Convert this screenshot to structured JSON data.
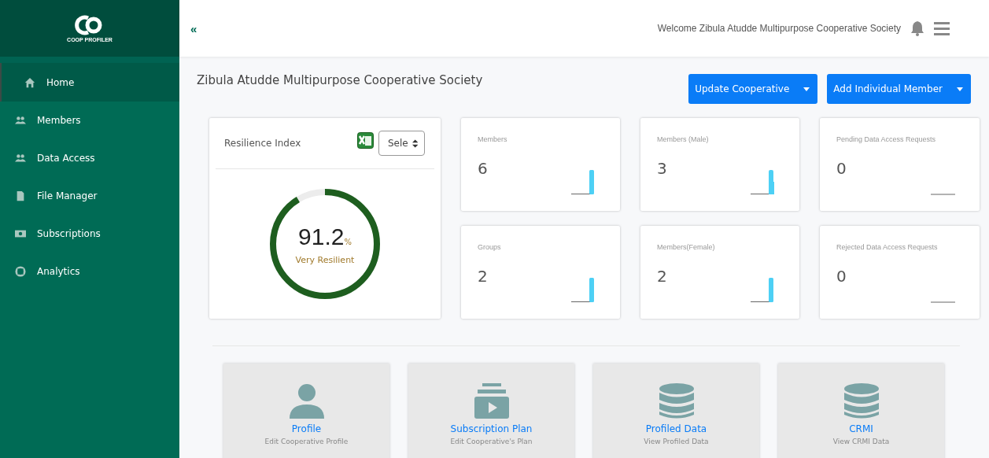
{
  "sidebar": {
    "logo_text": "COOP PROFILER",
    "items": [
      {
        "label": "Home",
        "kind": "home",
        "selected": true
      },
      {
        "label": "Members",
        "kind": "users",
        "selected": false
      },
      {
        "label": "Data Access",
        "kind": "users",
        "selected": false
      },
      {
        "label": "File Manager",
        "kind": "file",
        "selected": false
      },
      {
        "label": "Subscriptions",
        "kind": "money",
        "selected": false
      },
      {
        "label": "Analytics",
        "kind": "lifering",
        "selected": false
      }
    ]
  },
  "topbar": {
    "collapse": "«",
    "welcome": "Welcome Zibula Atudde Multipurpose Cooperative Society"
  },
  "page": {
    "title": "Zibula Atudde Multipurpose Cooperative Society",
    "buttons": [
      "Update Cooperative",
      "Add Individual Member"
    ]
  },
  "resilience": {
    "title": "Resilience Index",
    "select": "Sele",
    "level": 0.912,
    "value": "91.2",
    "unit": "%",
    "rating": "Very Resilient"
  },
  "stats": [
    {
      "label": "Members",
      "value": "6",
      "kind": "bar"
    },
    {
      "label": "Members (Male)",
      "value": "3",
      "kind": "step"
    },
    {
      "label": "Pending Data Access Requests",
      "value": "0",
      "kind": "flat"
    },
    {
      "label": "Groups",
      "value": "2",
      "kind": "bar"
    },
    {
      "label": "Members(Female)",
      "value": "2",
      "kind": "bar"
    },
    {
      "label": "Rejected Data Access Requests",
      "value": "0",
      "kind": "flat"
    }
  ],
  "tiles": [
    {
      "title": "Profile",
      "subtitle": "Edit Cooperative Profile",
      "kind": "person"
    },
    {
      "title": "Subscription Plan",
      "subtitle": "Edit Cooperative's Plan",
      "kind": "video"
    },
    {
      "title": "Profiled Data",
      "subtitle": "View Profiled Data",
      "kind": "database"
    },
    {
      "title": "CRMI",
      "subtitle": "View CRMI Data",
      "kind": "database"
    }
  ]
}
